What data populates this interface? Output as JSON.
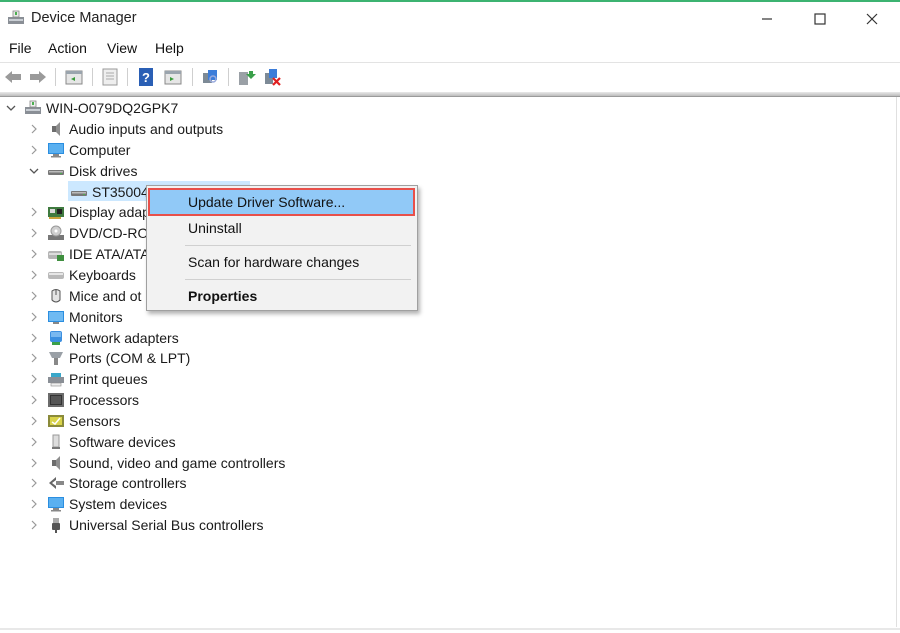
{
  "window": {
    "title": "Device Manager",
    "controls": {
      "minimize": "minimize-icon",
      "maximize": "maximize-icon",
      "close": "close-icon"
    }
  },
  "menubar": [
    {
      "label": "File"
    },
    {
      "label": "Action"
    },
    {
      "label": "View"
    },
    {
      "label": "Help"
    }
  ],
  "toolbar": [
    {
      "icon": "back-arrow-icon"
    },
    {
      "icon": "forward-arrow-icon"
    },
    {
      "icon": "show-hide-console-tree-icon"
    },
    {
      "icon": "properties-icon"
    },
    {
      "icon": "help-icon"
    },
    {
      "icon": "show-action-pane-icon"
    },
    {
      "icon": "scan-hardware-icon"
    },
    {
      "icon": "update-driver-icon"
    },
    {
      "icon": "uninstall-device-icon"
    }
  ],
  "tree": {
    "root": {
      "label": "WIN-O079DQ2GPK7",
      "expanded": true
    },
    "categories": [
      {
        "label": "Audio inputs and outputs",
        "icon": "speaker-icon",
        "expanded": false
      },
      {
        "label": "Computer",
        "icon": "computer-icon",
        "expanded": false
      },
      {
        "label": "Disk drives",
        "icon": "disk-drive-icon",
        "expanded": true,
        "children": [
          {
            "label": "ST35004",
            "icon": "disk-drive-icon",
            "selected": true
          }
        ]
      },
      {
        "label": "Display adap",
        "icon": "display-adapter-icon",
        "expanded": false
      },
      {
        "label": "DVD/CD-RO",
        "icon": "dvd-drive-icon",
        "expanded": false
      },
      {
        "label": "IDE ATA/ATA",
        "icon": "ide-controller-icon",
        "expanded": false
      },
      {
        "label": "Keyboards",
        "icon": "keyboard-icon",
        "expanded": false
      },
      {
        "label": "Mice and ot",
        "icon": "mouse-icon",
        "expanded": false
      },
      {
        "label": "Monitors",
        "icon": "monitor-icon",
        "expanded": false
      },
      {
        "label": "Network adapters",
        "icon": "network-adapter-icon",
        "expanded": false
      },
      {
        "label": "Ports (COM & LPT)",
        "icon": "port-icon",
        "expanded": false
      },
      {
        "label": "Print queues",
        "icon": "printer-icon",
        "expanded": false
      },
      {
        "label": "Processors",
        "icon": "processor-icon",
        "expanded": false
      },
      {
        "label": "Sensors",
        "icon": "sensor-icon",
        "expanded": false
      },
      {
        "label": "Software devices",
        "icon": "software-device-icon",
        "expanded": false
      },
      {
        "label": "Sound, video and game controllers",
        "icon": "speaker-icon",
        "expanded": false
      },
      {
        "label": "Storage controllers",
        "icon": "storage-controller-icon",
        "expanded": false
      },
      {
        "label": "System devices",
        "icon": "system-device-icon",
        "expanded": false
      },
      {
        "label": "Universal Serial Bus controllers",
        "icon": "usb-icon",
        "expanded": false
      }
    ]
  },
  "context_menu": {
    "items": [
      {
        "label": "Update Driver Software...",
        "highlighted": true
      },
      {
        "label": "Uninstall"
      },
      {
        "label": "Scan for hardware changes"
      },
      {
        "label": "Properties",
        "bold": true
      }
    ]
  },
  "colors": {
    "selection": "#cce8ff",
    "menu_highlight": "#91c9f7",
    "annotation_box": "#e8504a",
    "top_accent": "#3cb371"
  }
}
